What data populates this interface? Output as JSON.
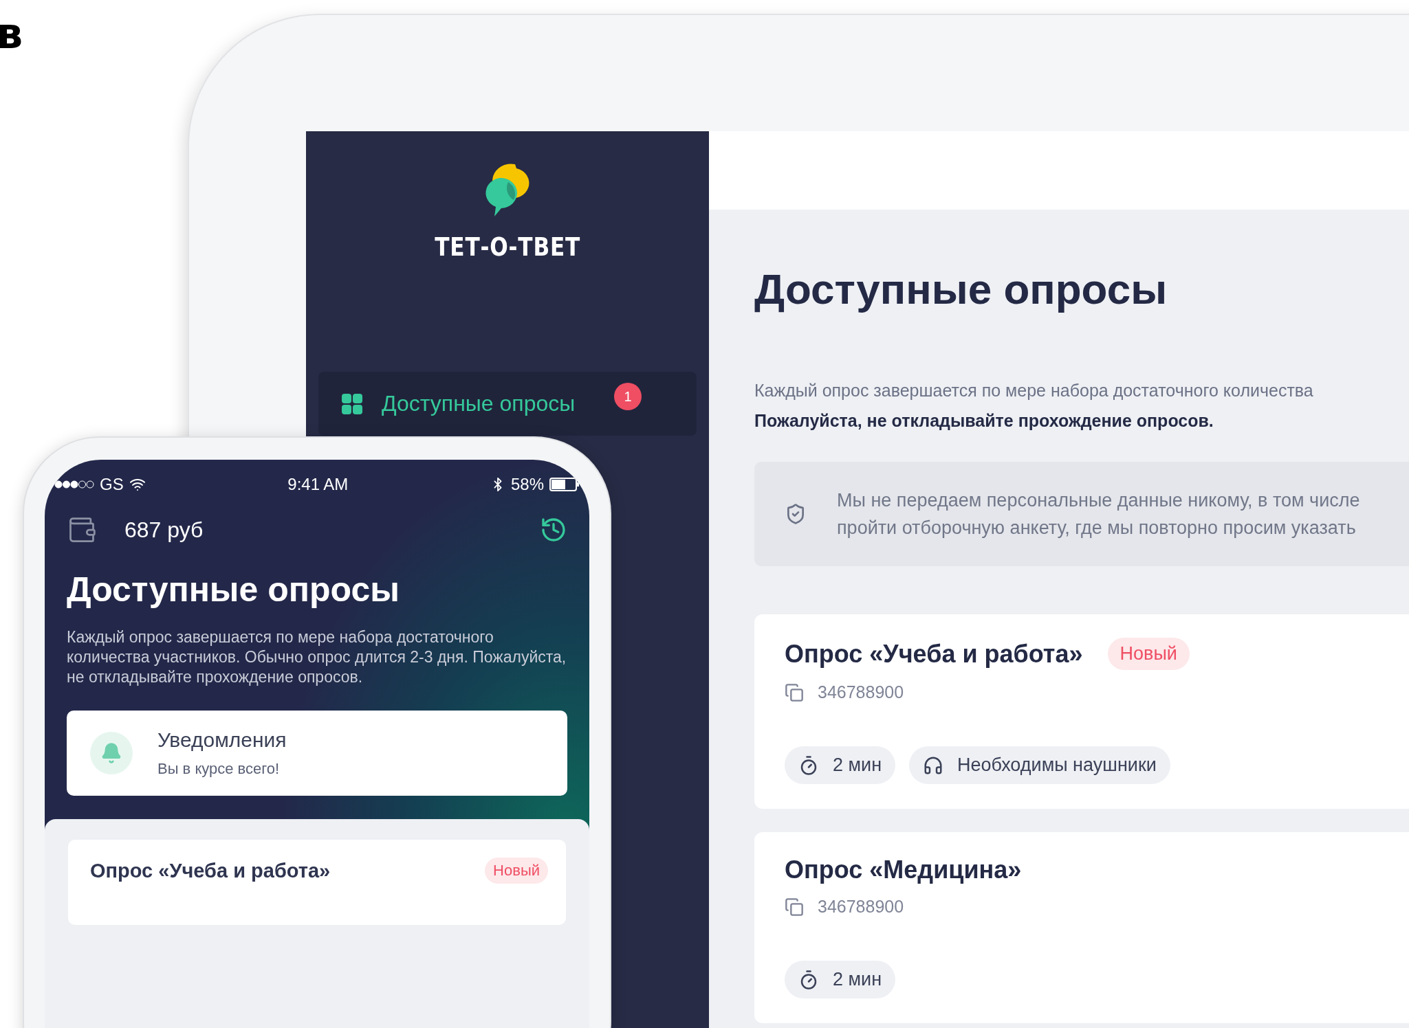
{
  "corner_letter": "в",
  "tablet": {
    "sidebar": {
      "logo_text": "ТЕТ-О-ТВЕТ",
      "menu": [
        {
          "label": "Доступные опросы",
          "selected": true,
          "badge": "1"
        }
      ]
    },
    "main": {
      "title": "Доступные опросы",
      "intro": "Каждый опрос завершается по мере набора достаточного количества",
      "intro_bold": "Пожалуйста, не откладывайте прохождение опросов.",
      "notice_lines": [
        "Мы не передаем персональные данные никому, в том числе",
        "пройти отборочную анкету, где мы повторно просим указать"
      ],
      "surveys": [
        {
          "title": "Опрос «Учеба и работа»",
          "badge": "Новый",
          "code": "346788900",
          "chips": [
            {
              "kind": "duration",
              "label": "2 мин"
            },
            {
              "kind": "headphones",
              "label": "Необходимы наушники"
            }
          ]
        },
        {
          "title": "Опрос «Медицина»",
          "code": "346788900",
          "chips": [
            {
              "kind": "duration",
              "label": "2 мин"
            }
          ]
        }
      ]
    }
  },
  "phone": {
    "status_bar": {
      "carrier": "GS",
      "time": "9:41 AM",
      "battery": "58%"
    },
    "balance": "687 руб",
    "title": "Доступные опросы",
    "intro": "Каждый опрос завершается по мере набора достаточного количества участников. Обычно опрос длится 2-3 дня. Пожалуйста, не откладывайте прохождение опросов.",
    "notification": {
      "title": "Уведомления",
      "subtitle": "Вы в курсе всего!"
    },
    "surveys": [
      {
        "title": "Опрос «Учеба и работа»",
        "badge": "Новый"
      }
    ]
  }
}
